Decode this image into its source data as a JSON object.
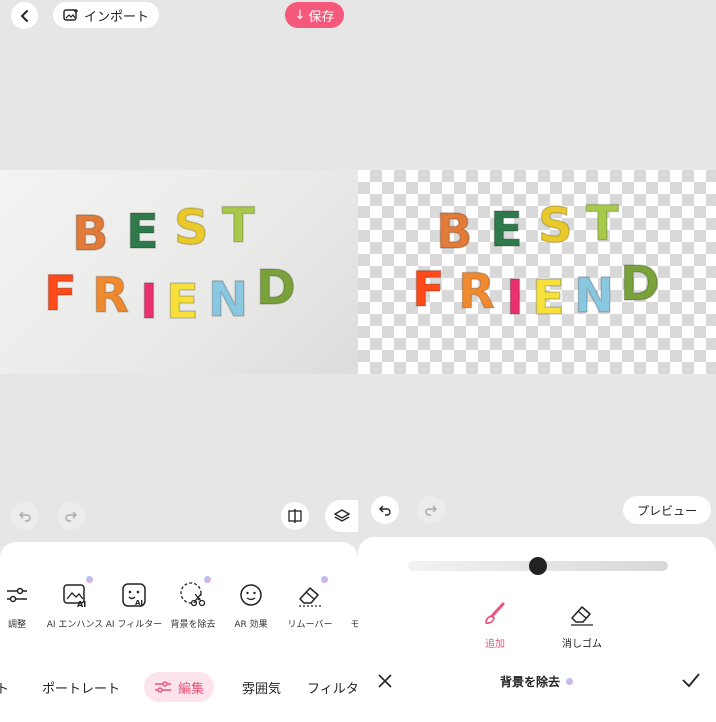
{
  "left": {
    "import_label": "インポート",
    "save_label": "保存",
    "tools": [
      {
        "label": "調整",
        "icon": "sliders-icon"
      },
      {
        "label": "AI エンハンス",
        "icon": "ai-enhance-icon",
        "premium": true
      },
      {
        "label": "AI フィルター",
        "icon": "ai-filter-icon"
      },
      {
        "label": "背景を除去",
        "icon": "cut-background-icon",
        "premium": true
      },
      {
        "label": "AR 効果",
        "icon": "ar-face-icon"
      },
      {
        "label": "リムーバー",
        "icon": "eraser-icon",
        "premium": true
      },
      {
        "label": "モ",
        "icon": ""
      }
    ],
    "tabs": [
      "ト",
      "ポートレート",
      "編集",
      "雰囲気",
      "フィルタ"
    ],
    "active_tab": "編集"
  },
  "right": {
    "preview_label": "プレビュー",
    "slider_value": 0.5,
    "modes": [
      {
        "label": "追加",
        "icon": "brush-icon",
        "active": true
      },
      {
        "label": "消しゴム",
        "icon": "eraser-icon",
        "active": false
      }
    ],
    "title": "背景を除去"
  },
  "photo": {
    "line1": [
      "B",
      "E",
      "S",
      "T"
    ],
    "line2": [
      "F",
      "R",
      "I",
      "E",
      "N",
      "D"
    ],
    "colors": {
      "B": "#e07b3a",
      "E1": "#2e7a4a",
      "S": "#eaca2a",
      "T": "#a8c94a",
      "F": "#ff4a1a",
      "R": "#f08a30",
      "I": "#e8316e",
      "E2": "#f7e03a",
      "N": "#8ac7e0",
      "D": "#7aa23a"
    }
  },
  "colors": {
    "accent": "#f4587a",
    "accent_light": "#fde4ec"
  }
}
